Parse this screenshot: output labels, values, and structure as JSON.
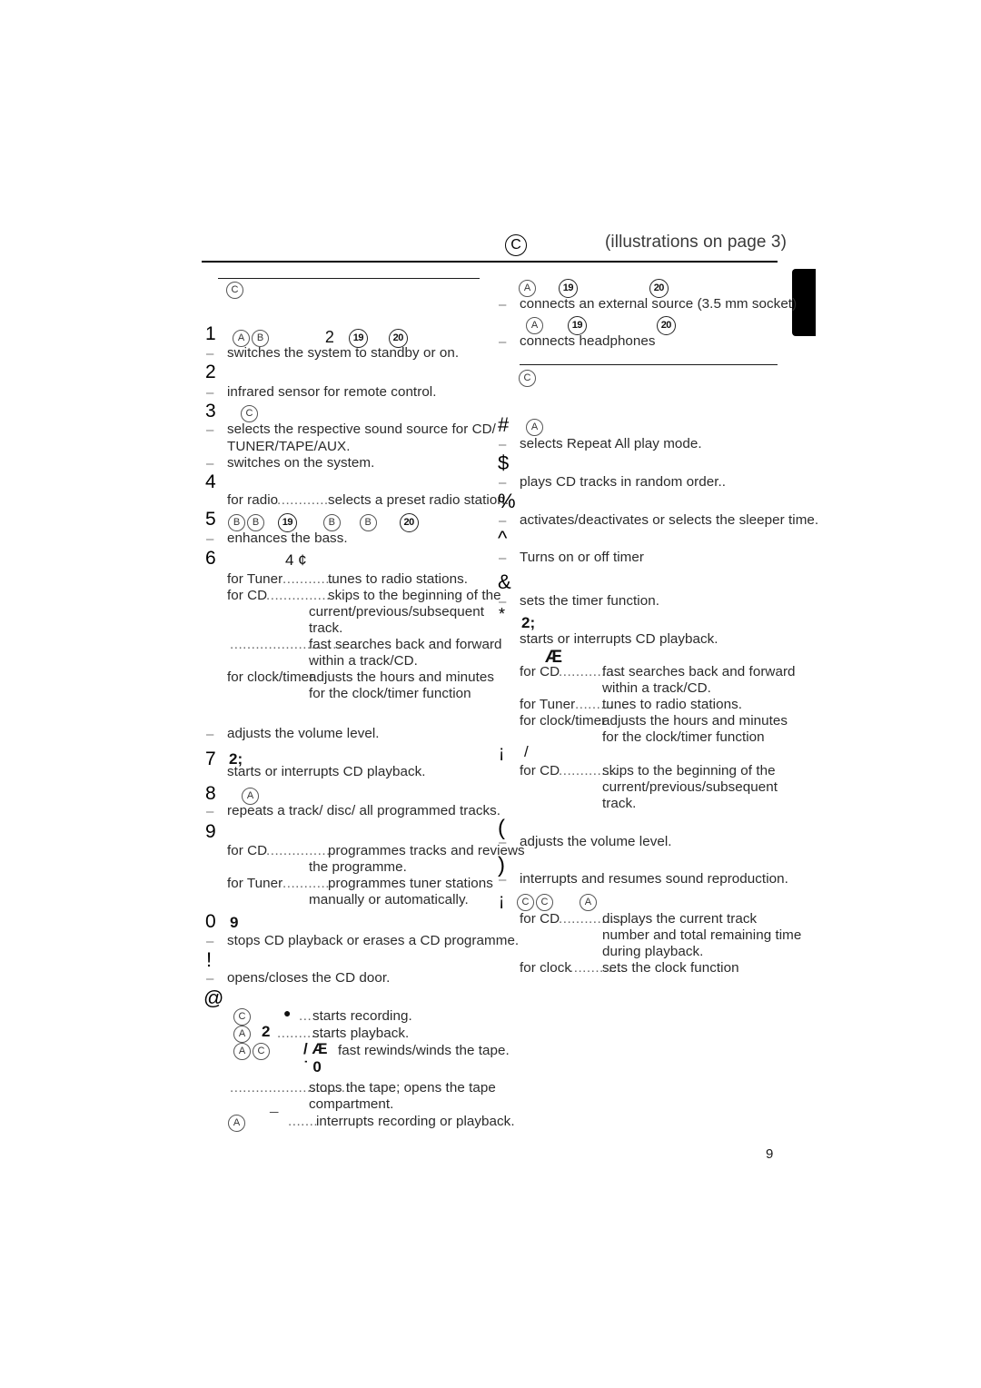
{
  "header": {
    "circle_label": "C",
    "title": "(illustrations on page 3)"
  },
  "page_number": "9",
  "left_column": {
    "section_circle": "C",
    "entries": [
      {
        "marker": "1",
        "glyphs": "Ⓐ Ⓑ        2  ⑲   ⑳",
        "lines": [
          {
            "dash": "–",
            "text": "switches the system to standby or on."
          }
        ]
      },
      {
        "marker": "2",
        "glyphs": "",
        "lines": [
          {
            "dash": "–",
            "text": "infrared sensor for remote control."
          }
        ]
      },
      {
        "marker": "3",
        "glyphs": "Ⓒ",
        "lines": [
          {
            "dash": "–",
            "text": "selects the respective sound source for CD/"
          },
          {
            "dash": "",
            "text": "TUNER/TAPE/AUX."
          },
          {
            "dash": "–",
            "text": "switches on the system."
          }
        ]
      },
      {
        "marker": "4",
        "glyphs": "",
        "lines": [
          {
            "dash": "",
            "label": "for radio",
            "dots": "............",
            "text": "selects a preset radio station."
          }
        ]
      },
      {
        "marker": "5",
        "glyphs": "ⒷⒷ ⑲    Ⓑ   Ⓑ   ⑳",
        "lines": [
          {
            "dash": "–",
            "text": "enhances the bass."
          }
        ]
      },
      {
        "marker": "6",
        "glyphs": "4 ¢",
        "lines": [
          {
            "label": "for Tuner",
            "dots": "............",
            "text": "tunes to radio stations."
          },
          {
            "label": "for CD",
            "dots": "...............",
            "text": "skips to the beginning of the"
          },
          {
            "label": "",
            "dots": "",
            "text": "current/previous/subsequent"
          },
          {
            "label": "",
            "dots": "",
            "text": "track."
          },
          {
            "label": "",
            "dots": "................................",
            "text": "fast searches back and forward"
          },
          {
            "label": "",
            "dots": "",
            "text": "within a track/CD."
          },
          {
            "label": "for clock/timer",
            "dots": "",
            "text": "adjusts the hours and minutes"
          },
          {
            "label": "",
            "dots": "",
            "text": "for the clock/timer function"
          },
          {
            "dash": "–",
            "text": "adjusts the volume level."
          }
        ]
      },
      {
        "marker": "7",
        "glyphs": "2;",
        "lines": [
          {
            "dash": "",
            "text": "starts or interrupts CD playback."
          }
        ]
      },
      {
        "marker": "8",
        "glyphs": "Ⓐ",
        "lines": [
          {
            "dash": "–",
            "text": "repeats a track/ disc/ all programmed tracks."
          }
        ]
      },
      {
        "marker": "9",
        "glyphs": "",
        "lines": [
          {
            "label": "for CD",
            "dots": "...............",
            "text": "programmes tracks and reviews"
          },
          {
            "label": "",
            "dots": "",
            "text": "the programme."
          },
          {
            "label": "for Tuner",
            "dots": "............",
            "text": "programmes tuner stations"
          },
          {
            "label": "",
            "dots": "",
            "text": "manually or automatically."
          }
        ]
      },
      {
        "marker": "0",
        "glyphs": "9",
        "lines": [
          {
            "dash": "–",
            "text": "stops CD playback or erases a CD programme."
          }
        ]
      },
      {
        "marker": "!",
        "glyphs": "",
        "lines": [
          {
            "dash": "–",
            "text": "opens/closes the CD door."
          }
        ]
      },
      {
        "marker": "@",
        "glyphs": "",
        "lines": [
          {
            "prefix": "Ⓒ",
            "sym": "●",
            "dots": "...",
            "text": "starts recording."
          },
          {
            "prefix": "Ⓐ",
            "sym": "2",
            "dots": "............",
            "text": "starts playback."
          },
          {
            "prefix": "Ⓐ Ⓒ",
            "sym": "/ Æ",
            "dots": "",
            "text": "fast rewinds/winds the tape."
          },
          {
            "prefix": "",
            "sym": "˙  0",
            "dots": "",
            "text": ""
          },
          {
            "prefix": "",
            "sym": "",
            "dots": "................................",
            "text": "stops the tape; opens the tape"
          },
          {
            "prefix": "",
            "sym": "",
            "dots": "",
            "text": "compartment."
          },
          {
            "prefix": "Ⓐ",
            "sym": "¯",
            "dots": ".......",
            "text": "interrupts recording or playback."
          }
        ]
      }
    ]
  },
  "right_column": {
    "top_entries": [
      {
        "glyphs": "Ⓐ   ⑲              ⑳",
        "dash": "–",
        "text": "connects an external source (3.5 mm socket)"
      },
      {
        "glyphs": "Ⓐ    ⑲              ⑳",
        "dash": "–",
        "text": "connects headphones"
      }
    ],
    "section_circle": "C",
    "entries": [
      {
        "marker": "#",
        "glyphs": "Ⓐ",
        "lines": [
          {
            "dash": "–",
            "text": "selects Repeat All play mode."
          }
        ]
      },
      {
        "marker": "$",
        "glyphs": "",
        "lines": [
          {
            "dash": "–",
            "text": "plays CD tracks in random order.."
          }
        ]
      },
      {
        "marker": "%",
        "glyphs": "",
        "lines": [
          {
            "dash": "–",
            "text": "activates/deactivates or selects the sleeper time."
          }
        ]
      },
      {
        "marker": "^",
        "glyphs": "",
        "lines": [
          {
            "dash": "–",
            "text": "Turns on or off timer"
          }
        ]
      },
      {
        "marker": "&",
        "glyphs": "",
        "lines": [
          {
            "dash": "–",
            "text": "sets the timer function."
          }
        ]
      },
      {
        "marker": "*",
        "glyphs": "2;",
        "lines": [
          {
            "dash": "",
            "text": "starts or interrupts CD playback."
          },
          {
            "glyph2": "Æ"
          },
          {
            "label": "for CD",
            "dots": "...............",
            "text": "fast searches back and forward"
          },
          {
            "label": "",
            "dots": "",
            "text": "within a track/CD."
          },
          {
            "label": "for Tuner",
            "dots": "............",
            "text": "tunes to radio stations."
          },
          {
            "label": "for clock/timer",
            "dots": "",
            "text": "adjusts the hours and minutes"
          },
          {
            "label": "",
            "dots": "",
            "text": "for the clock/timer function"
          }
        ]
      },
      {
        "marker": "¡",
        "glyphs": "/",
        "lines": [
          {
            "label": "for CD",
            "dots": "...............",
            "text": "skips to the beginning of the"
          },
          {
            "label": "",
            "dots": "",
            "text": "current/previous/subsequent"
          },
          {
            "label": "",
            "dots": "",
            "text": "track."
          }
        ]
      },
      {
        "marker": "(",
        "glyphs": "",
        "lines": [
          {
            "dash": "–",
            "text": "adjusts the volume level."
          }
        ]
      },
      {
        "marker": ")",
        "glyphs": "",
        "lines": [
          {
            "dash": "–",
            "text": "interrupts and resumes sound reproduction."
          }
        ]
      },
      {
        "marker": "¡",
        "glyphs": "Ⓒ Ⓒ     Ⓐ",
        "lines": [
          {
            "label": "for CD",
            "dots": "...............",
            "text": "displays the current track"
          },
          {
            "label": "",
            "dots": "",
            "text": "number and total remaining time"
          },
          {
            "label": "",
            "dots": "",
            "text": "during playback."
          },
          {
            "label": "for clock",
            "dots": ".............",
            "text": "sets the clock function"
          }
        ]
      }
    ]
  }
}
